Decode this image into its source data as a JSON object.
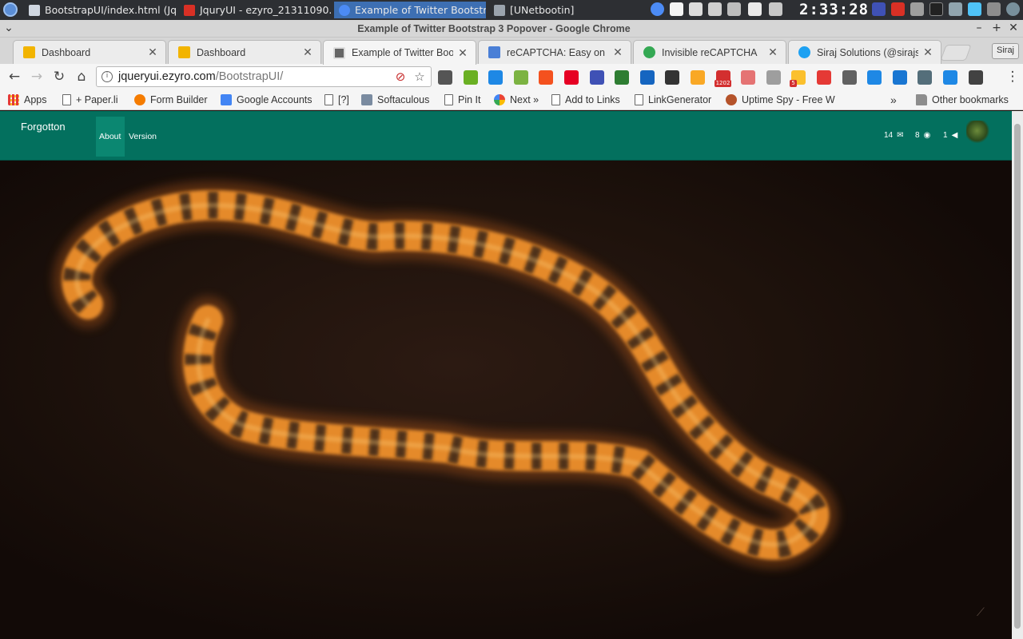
{
  "taskbar": {
    "tasks": [
      {
        "label": "BootstrapUI/index.html (Jq...",
        "color": "#cfd6e0"
      },
      {
        "label": "JquryUI - ezyro_21311090...",
        "color": "#d93025"
      },
      {
        "label": "Example of Twitter Bootstr...",
        "color": "#4c8bf5"
      },
      {
        "label": "[UNetbootin]",
        "color": "#9aa3ad"
      }
    ],
    "clock": "2:33:28"
  },
  "window": {
    "title": "Example of Twitter Bootstrap 3 Popover - Google Chrome",
    "min": "–",
    "max": "+",
    "close": "✕"
  },
  "tabs": [
    {
      "label": "Dashboard",
      "color": "#f2b400",
      "close": "✕"
    },
    {
      "label": "Dashboard",
      "color": "#f2b400",
      "close": "✕"
    },
    {
      "label": "Example of Twitter Boot",
      "color": "#666666",
      "close": "✕",
      "active": true
    },
    {
      "label": "reCAPTCHA: Easy on H",
      "color": "#4a7fd6",
      "close": "✕"
    },
    {
      "label": "Invisible reCAPTCHA",
      "color": "#34a853",
      "close": "✕"
    },
    {
      "label": "Siraj Solutions (@sirajs",
      "color": "#1da1f2",
      "close": "✕"
    }
  ],
  "profile": "Siraj",
  "toolbar": {
    "back": "←",
    "forward": "→",
    "reload": "↻",
    "home": "⌂",
    "url_host": "jqueryui.ezyro.com",
    "url_path": "/BootstrapUI/",
    "info": "i",
    "star": "☆",
    "translate": "⊘",
    "menu": "⋮",
    "ext_colors": [
      "#555555",
      "#6ab023",
      "#1e88e5",
      "#7cb342",
      "#f4511e",
      "#e60023",
      "#3f51b5",
      "#2e7d32",
      "#1565c0",
      "#333333",
      "#f9a825",
      "#d32f2f",
      "#e57373",
      "#9e9e9e",
      "#fbc02d",
      "#e53935",
      "#616161",
      "#1e88e5",
      "#1976d2",
      "#546e7a",
      "#1e88e5",
      "#424242"
    ],
    "ext_badges": {
      "mail": "1202",
      "idea": "5"
    }
  },
  "bookmarks": [
    {
      "label": "Apps",
      "icon": "apps-icon",
      "color": "#e53935"
    },
    {
      "label": "+ Paper.li",
      "icon": "page-icon"
    },
    {
      "label": "Form Builder",
      "icon": "form-builder-icon",
      "color": "#f57c00"
    },
    {
      "label": "Google Accounts",
      "icon": "google-accounts-icon",
      "color": "#4285f4"
    },
    {
      "label": "[?]",
      "icon": "page-icon"
    },
    {
      "label": "Softaculous",
      "icon": "softaculous-icon",
      "color": "#7a8ba0"
    },
    {
      "label": "Pin It",
      "icon": "page-icon"
    },
    {
      "label": "Next »",
      "icon": "google-icon",
      "color": "#ea4335"
    },
    {
      "label": "Add to Links",
      "icon": "page-icon"
    },
    {
      "label": "LinkGenerator",
      "icon": "page-icon"
    },
    {
      "label": "Uptime Spy - Free W",
      "icon": "uptime-spy-icon",
      "color": "#b5532a"
    }
  ],
  "bookmarks_overflow": "»",
  "other_bookmarks": "Other bookmarks",
  "page": {
    "brand": "Forgotton",
    "nav": [
      {
        "label": "About",
        "active": true
      },
      {
        "label": "Version",
        "active": false
      }
    ],
    "stats": [
      {
        "value": "14",
        "icon": "envelope-icon",
        "glyph": "✉"
      },
      {
        "value": "8",
        "icon": "eye-icon",
        "glyph": "◉"
      },
      {
        "value": "1",
        "icon": "bullhorn-icon",
        "glyph": "◀"
      }
    ],
    "resize_glyph": "⟋"
  }
}
